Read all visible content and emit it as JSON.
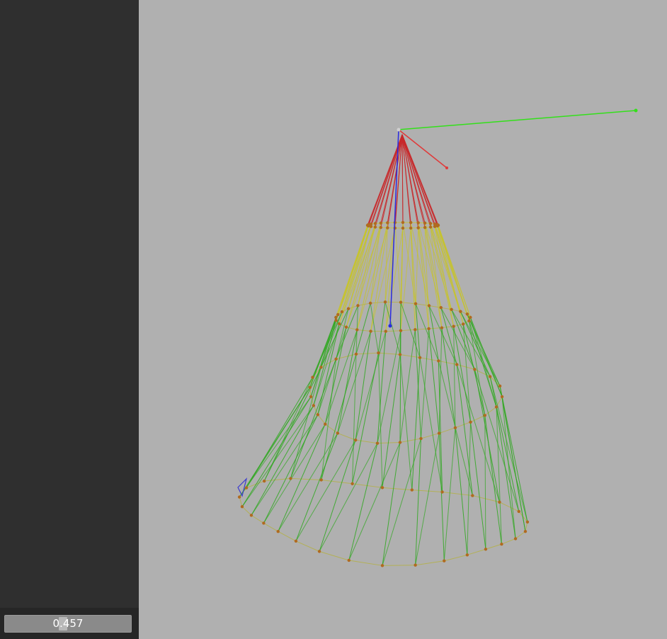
{
  "sidebar": {
    "slider": {
      "value_label": "0.457",
      "value": 0.457
    }
  },
  "viewport": {
    "background_color": "#b0b0b0",
    "mesh_colors": {
      "tip": "#c8282a",
      "upper": "#c8c428",
      "lower": "#2ea81e",
      "nodes": "#b06a20"
    },
    "axis_colors": {
      "x": "#e03a3a",
      "y": "#33e01a",
      "z": "#2a2ae0"
    }
  }
}
